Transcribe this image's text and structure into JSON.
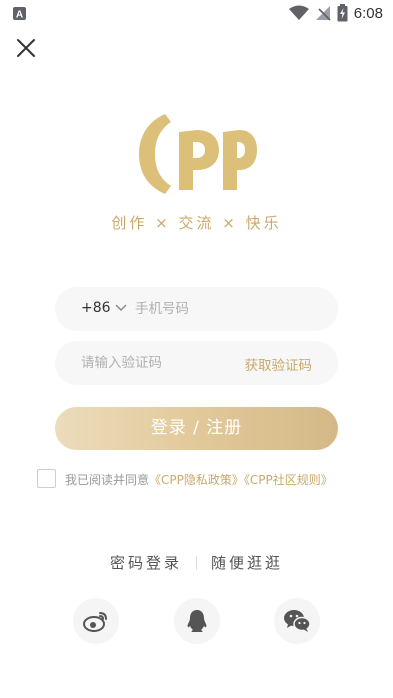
{
  "status_bar": {
    "time": "6:08",
    "battery_level": 0.75
  },
  "brand": {
    "logo_text": "CPP",
    "slogan": "创作 × 交流 × 快乐"
  },
  "login": {
    "country_code": "+86",
    "phone_placeholder": "手机号码",
    "code_placeholder": "请输入验证码",
    "get_code_label": "获取验证码",
    "submit_label": "登录 / 注册"
  },
  "agreement": {
    "prefix": "我已阅读并同意",
    "privacy_link": "《CPP隐私政策》",
    "rules_link": "《CPP社区规则》",
    "checked": false
  },
  "alt_login": {
    "password_login": "密码登录",
    "browse": "随便逛逛"
  },
  "social": [
    "weibo-icon",
    "qq-icon",
    "wechat-icon"
  ],
  "colors": {
    "accent": "#c9a96a",
    "logo": "#dcc07a",
    "button_start": "#ecdcbc",
    "button_end": "#d4b888"
  }
}
